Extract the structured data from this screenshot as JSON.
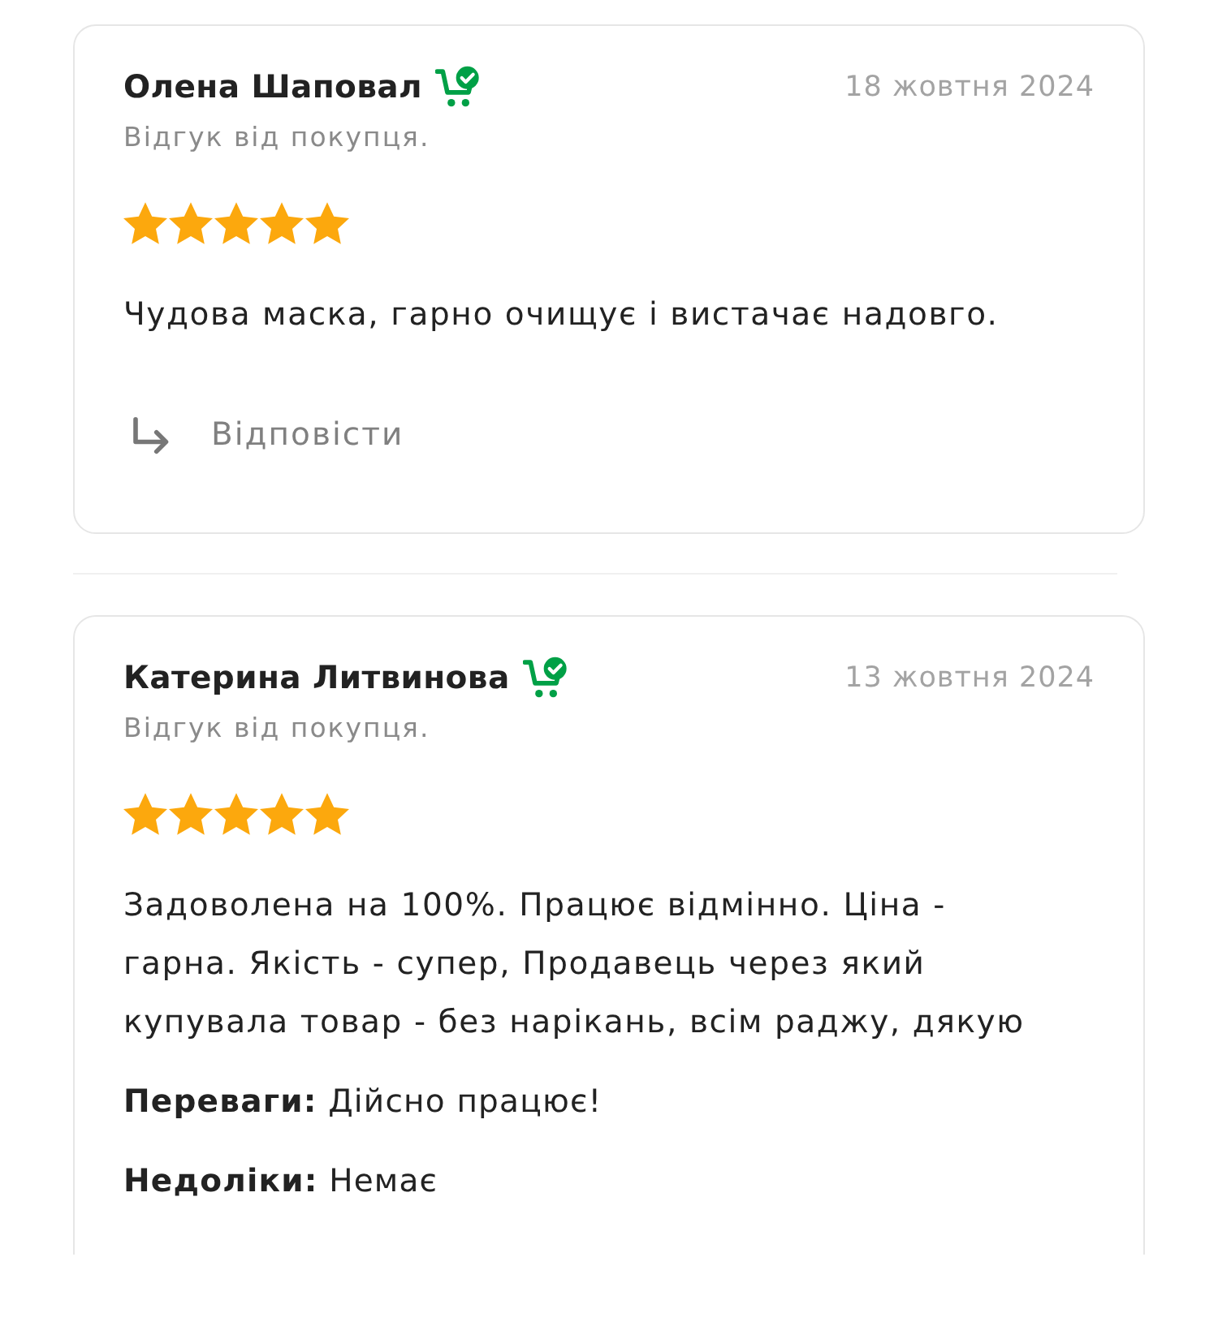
{
  "reviews": [
    {
      "author": "Олена Шаповал",
      "verified_buyer": true,
      "date": "18 жовтня 2024",
      "source": "Відгук від покупця.",
      "stars": 5,
      "text": "Чудова маска, гарно очищує і вистачає надовго.",
      "reply_label": "Відповісти"
    },
    {
      "author": "Катерина Литвинова",
      "verified_buyer": true,
      "date": "13 жовтня 2024",
      "source": "Відгук від покупця.",
      "stars": 5,
      "text": "Задоволена на 100%. Працює відмінно. Ціна - гарна. Якість - супер, Продавець через який купувала товар - без нарікань, всім раджу, дякую",
      "details": [
        "**Переваги:** Дійсно працює!",
        "**Недоліки:** Немає"
      ]
    }
  ]
}
